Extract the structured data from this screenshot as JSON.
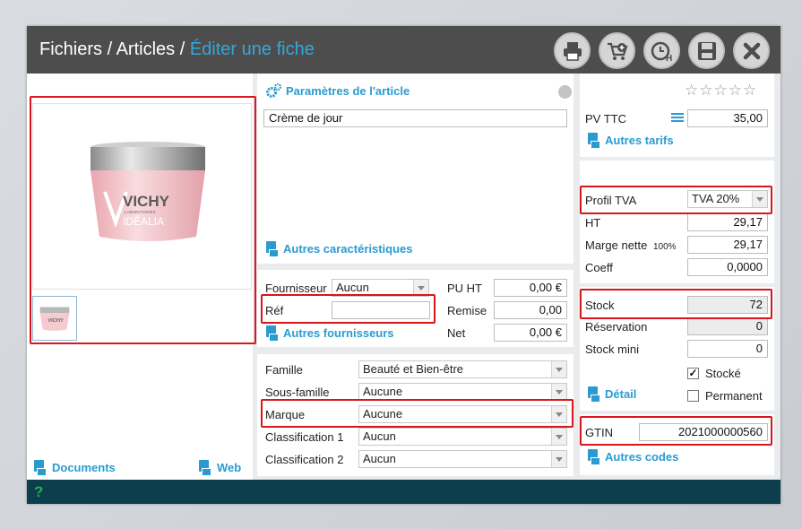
{
  "breadcrumb": {
    "part1": "Fichiers",
    "sep1": " / ",
    "part2": "Articles",
    "sep2": " / ",
    "active": "Éditer une fiche"
  },
  "toolbar": {
    "buttons": [
      {
        "name": "print-button",
        "icon": "printer-icon"
      },
      {
        "name": "cart-button",
        "icon": "cart-add-icon"
      },
      {
        "name": "history-button",
        "icon": "clock-h-icon"
      },
      {
        "name": "save-button",
        "icon": "floppy-icon"
      },
      {
        "name": "close-button",
        "icon": "close-icon"
      }
    ]
  },
  "left": {
    "documents_link": "Documents",
    "web_link": "Web"
  },
  "params": {
    "title": "Paramètres de l'article",
    "name_value": "Crème de jour",
    "other_characteristics": "Autres caractéristiques"
  },
  "supplier": {
    "fournisseur_label": "Fournisseur",
    "fournisseur_value": "Aucun",
    "ref_label": "Réf",
    "ref_value": "",
    "other_suppliers": "Autres fournisseurs",
    "pu_ht_label": "PU HT",
    "pu_ht_value": "0,00 €",
    "remise_label": "Remise",
    "remise_value": "0,00",
    "net_label": "Net",
    "net_value": "0,00 €"
  },
  "classification": {
    "famille_label": "Famille",
    "famille_value": "Beauté et Bien-être",
    "sous_famille_label": "Sous-famille",
    "sous_famille_value": "Aucune",
    "marque_label": "Marque",
    "marque_value": "Aucune",
    "class1_label": "Classification 1",
    "class1_value": "Aucun",
    "class2_label": "Classification 2",
    "class2_value": "Aucun"
  },
  "pricing": {
    "pv_ttc_label": "PV TTC",
    "pv_ttc_value": "35,00",
    "autres_tarifs": "Autres tarifs",
    "profil_tva_label": "Profil TVA",
    "profil_tva_value": "TVA 20%",
    "ht_label": "HT",
    "ht_value": "29,17",
    "marge_label": "Marge nette",
    "marge_pct": "100%",
    "marge_value": "29,17",
    "coeff_label": "Coeff",
    "coeff_value": "0,0000"
  },
  "stock": {
    "stock_label": "Stock",
    "stock_value": "72",
    "reservation_label": "Réservation",
    "reservation_value": "0",
    "stock_mini_label": "Stock mini",
    "stock_mini_value": "0",
    "stocke_label": "Stocké",
    "stocke_checked": true,
    "permanent_label": "Permanent",
    "permanent_checked": false,
    "detail_link": "Détail"
  },
  "gtin": {
    "label": "GTIN",
    "value": "2021000000560",
    "autres_codes": "Autres codes"
  },
  "product_image": {
    "brand": "VICHY",
    "sub": "LABORATOIRES",
    "line": "IDÉALIA"
  },
  "rating": {
    "stars": 5,
    "filled": 0
  },
  "status": {
    "help": "?"
  },
  "colors": {
    "accent": "#2a9bd1",
    "title_active": "#31a9dd",
    "highlight": "#d8161b",
    "topbar": "#4d4d4d",
    "statusbar": "#0d3e4d"
  }
}
